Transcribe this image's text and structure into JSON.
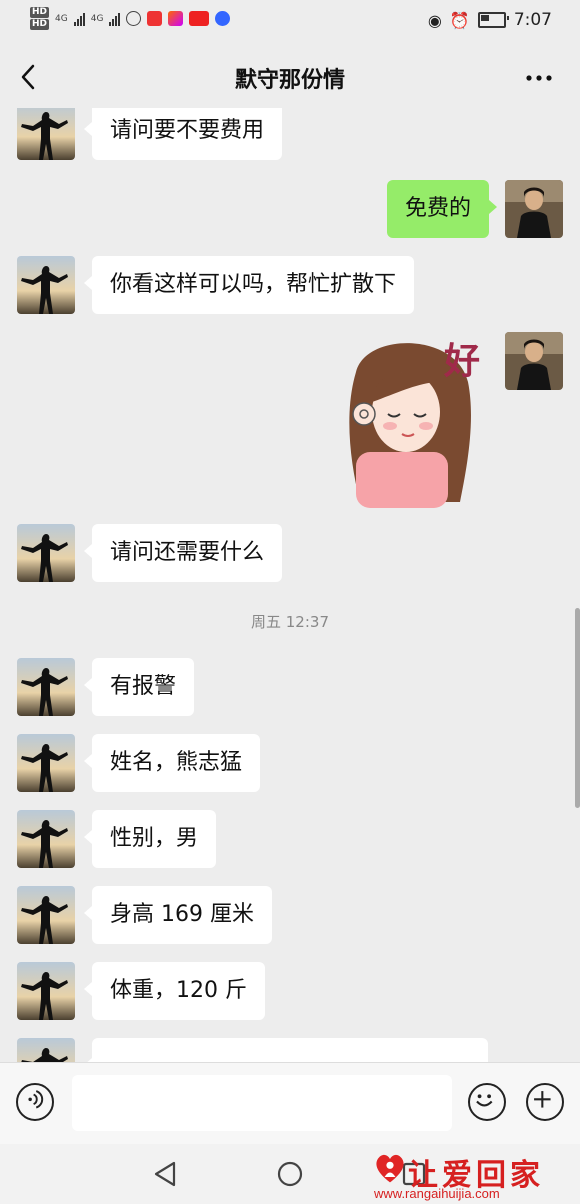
{
  "status_bar": {
    "hd_top": "HD",
    "hd_bottom": "HD",
    "sig1": "4G",
    "sig2": "4G",
    "time": "7:07"
  },
  "header": {
    "title": "默守那份情"
  },
  "messages": [
    {
      "side": "left",
      "text": "请问要不要费用"
    },
    {
      "side": "right",
      "text": "免费的"
    },
    {
      "side": "left",
      "text": "你看这样可以吗，帮忙扩散下"
    },
    {
      "side": "right",
      "sticker_text": "好"
    },
    {
      "side": "left",
      "text": "请问还需要什么"
    },
    {
      "timestamp": "周五 12:37"
    },
    {
      "side": "left",
      "text": "有报警"
    },
    {
      "side": "left",
      "text": "姓名，熊志猛"
    },
    {
      "side": "left",
      "text": "性别，男"
    },
    {
      "side": "left",
      "text": "身高 169 厘米"
    },
    {
      "side": "left",
      "text": "体重，120 斤"
    }
  ],
  "watermark": {
    "name": "让爱回家",
    "url": "www.rangaihuijia.com"
  },
  "colors": {
    "background": "#ededed",
    "bubble_self": "#95ec69",
    "bubble_other": "#ffffff",
    "watermark": "#d62020"
  }
}
